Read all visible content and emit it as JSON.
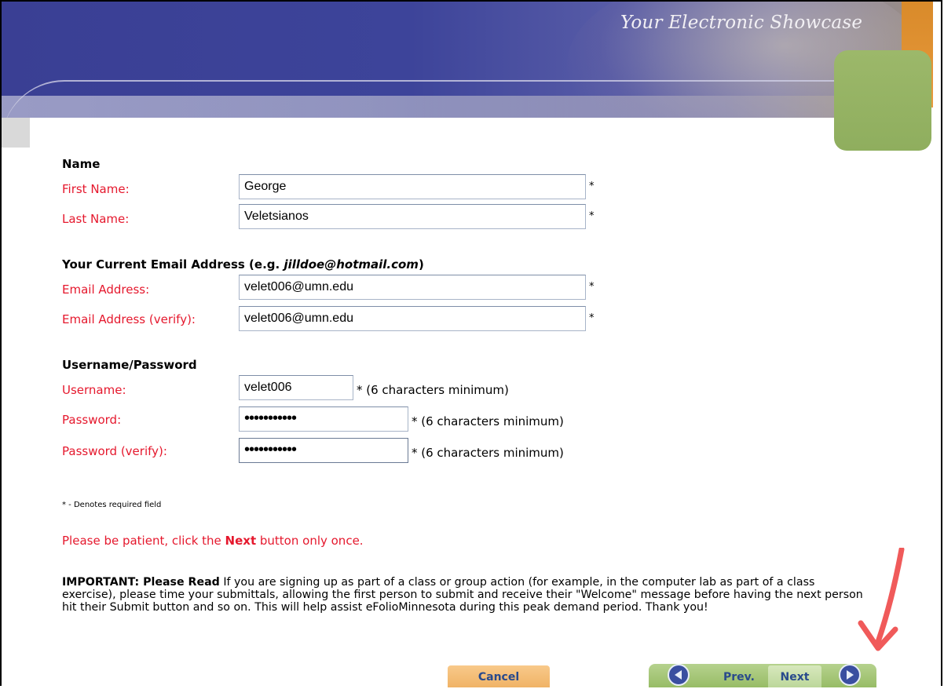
{
  "header": {
    "title": "Your Electronic Showcase"
  },
  "sections": {
    "name": "Name",
    "email_prefix": "Your Current Email Address (e.g. ",
    "email_example": "jilldoe@hotmail.com",
    "email_suffix": ")",
    "credentials": "Username/Password"
  },
  "fields": {
    "first_name": {
      "label": "First Name:",
      "value": "George"
    },
    "last_name": {
      "label": "Last Name:",
      "value": "Veletsianos"
    },
    "email": {
      "label": "Email Address:",
      "value": "velet006@umn.edu"
    },
    "email_verify": {
      "label": "Email Address (verify):",
      "value": "velet006@umn.edu"
    },
    "username": {
      "label": "Username:",
      "value": "velet006",
      "hint": "* (6 characters minimum)"
    },
    "password": {
      "label": "Password:",
      "value": "•••••••••••",
      "hint": "* (6 characters minimum)"
    },
    "password_verify": {
      "label": "Password (verify):",
      "value": "•••••••••••",
      "hint": "* (6 characters minimum)"
    }
  },
  "required_marker": "*",
  "footnote": "* - Denotes required field",
  "patience": {
    "before": "Please be patient, click the ",
    "bold": "Next",
    "after": " button only once."
  },
  "important": {
    "lead": "IMPORTANT: Please Read",
    "body": " If you are signing up as part of a class or group action (for example, in the computer lab as part of a class exercise), please time your submittals, allowing the first person to submit and receive their \"Welcome\" message before having the next person hit their Submit button and so on. This will help assist eFolioMinnesota during this peak demand period. Thank you!"
  },
  "buttons": {
    "cancel": "Cancel",
    "prev": "Prev.",
    "next": "Next"
  },
  "icons": {
    "prev": "arrow-left-icon",
    "next": "arrow-right-icon",
    "annotation": "red-arrow-icon"
  },
  "colors": {
    "required_label": "#e5182d",
    "banner": "#3d449a",
    "button_text": "#294a8c",
    "annotation": "#f05a5a"
  }
}
